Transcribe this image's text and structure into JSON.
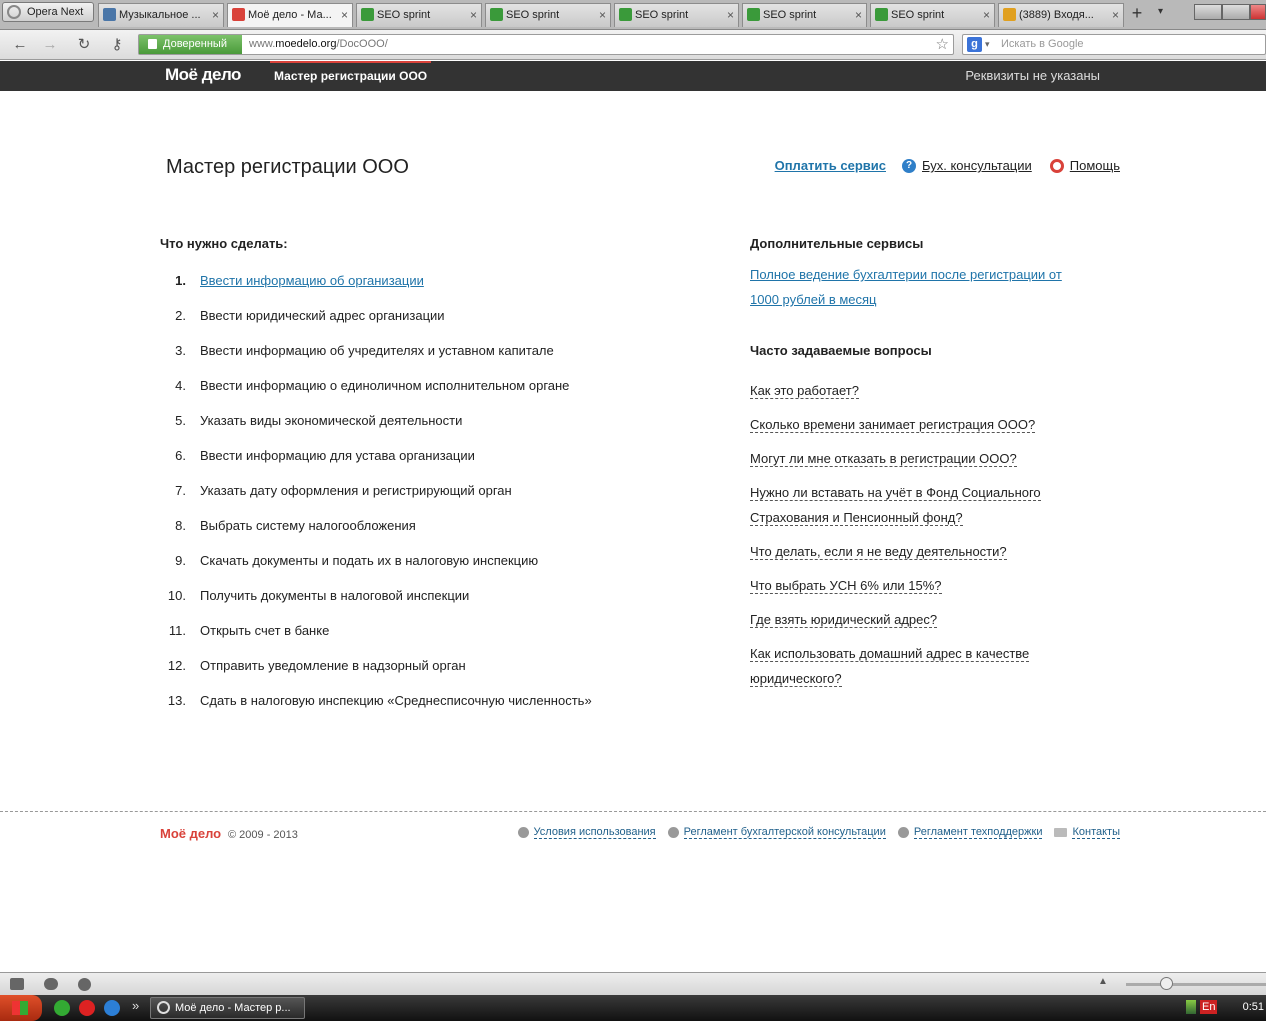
{
  "browser": {
    "menu_label": "Opera Next",
    "tabs": [
      {
        "label": "Музыкальное ...",
        "icon": "vk-icon",
        "color": "#4a76a8"
      },
      {
        "label": "Моё дело - Ма...",
        "icon": "moedelo-icon",
        "color": "#d9423a",
        "active": true
      },
      {
        "label": "SEO sprint",
        "icon": "seosprint-icon",
        "color": "#3a9a3a"
      },
      {
        "label": "SEO sprint",
        "icon": "seosprint-icon",
        "color": "#3a9a3a"
      },
      {
        "label": "SEO sprint",
        "icon": "seosprint-icon",
        "color": "#3a9a3a"
      },
      {
        "label": "SEO sprint",
        "icon": "seosprint-icon",
        "color": "#3a9a3a"
      },
      {
        "label": "SEO sprint",
        "icon": "seosprint-icon",
        "color": "#3a9a3a"
      },
      {
        "label": "(3889) Входя...",
        "icon": "mail-icon",
        "color": "#e0a020"
      }
    ],
    "tab_close": "×",
    "new_tab": "+",
    "trusted_label": "Доверенный",
    "url_prefix": "www.",
    "url_domain": "moedelo.org",
    "url_path": "/DocOOO/",
    "search_placeholder": "Искать в Google",
    "search_engine": "g"
  },
  "site": {
    "logo": "Моё дело",
    "nav_active": "Мастер регистрации ООО",
    "requisites": "Реквизиты не указаны",
    "accent_color": "#d9423a",
    "link_color": "#1f74a9"
  },
  "main": {
    "title": "Мастер регистрации ООО",
    "pay_link": "Оплатить сервис",
    "consult_link": "Бух. консультации",
    "consult_icon_glyph": "?",
    "help_link": "Помощь",
    "todo_heading": "Что нужно сделать:",
    "steps": [
      {
        "num": "1.",
        "text": "Ввести информацию об организации"
      },
      {
        "num": "2.",
        "text": "Ввести юридический адрес организации"
      },
      {
        "num": "3.",
        "text": "Ввести информацию об учредителях и уставном капитале"
      },
      {
        "num": "4.",
        "text": "Ввести информацию о единоличном исполнительном органе"
      },
      {
        "num": "5.",
        "text": "Указать виды экономической деятельности"
      },
      {
        "num": "6.",
        "text": "Ввести информацию для устава организации"
      },
      {
        "num": "7.",
        "text": "Указать дату оформления и регистрирующий орган"
      },
      {
        "num": "8.",
        "text": "Выбрать систему налогообложения"
      },
      {
        "num": "9.",
        "text": "Скачать документы и подать их в налоговую инспекцию"
      },
      {
        "num": "10.",
        "text": "Получить документы в налоговой инспекции"
      },
      {
        "num": "11.",
        "text": "Открыть счет в банке"
      },
      {
        "num": "12.",
        "text": "Отправить уведомление в надзорный орган"
      },
      {
        "num": "13.",
        "text": "Сдать в налоговую инспекцию «Среднесписочную численность»"
      }
    ],
    "extra_heading": "Дополнительные сервисы",
    "extra_link": "Полное ведение бухгалтерии после регистрации от 1000 рублей в месяц",
    "faq_heading": "Часто задаваемые вопросы",
    "faq": [
      "Как это работает?",
      "Сколько времени занимает регистрация ООО?",
      "Могут ли мне отказать в регистрации ООО?",
      "Нужно ли вставать на учёт в Фонд Социального Страхования и Пенсионный фонд?",
      "Что делать, если я не веду деятельности?",
      "Что выбрать УСН 6% или 15%?",
      "Где взять юридический адрес?",
      "Как использовать домашний адрес в качестве юридического?"
    ]
  },
  "footer": {
    "logo": "Моё дело",
    "copyright": "© 2009 - 2013",
    "links": [
      {
        "label": "Условия использования",
        "icon": "info-icon"
      },
      {
        "label": "Регламент бухгалтерской консультации",
        "icon": "info-icon"
      },
      {
        "label": "Регламент техподдержки",
        "icon": "info-icon"
      },
      {
        "label": "Контакты",
        "icon": "mail-icon"
      }
    ]
  },
  "taskbar": {
    "window_label": "Моё дело - Мастер р...",
    "lang": "En",
    "clock": "0:51",
    "more": "»"
  }
}
